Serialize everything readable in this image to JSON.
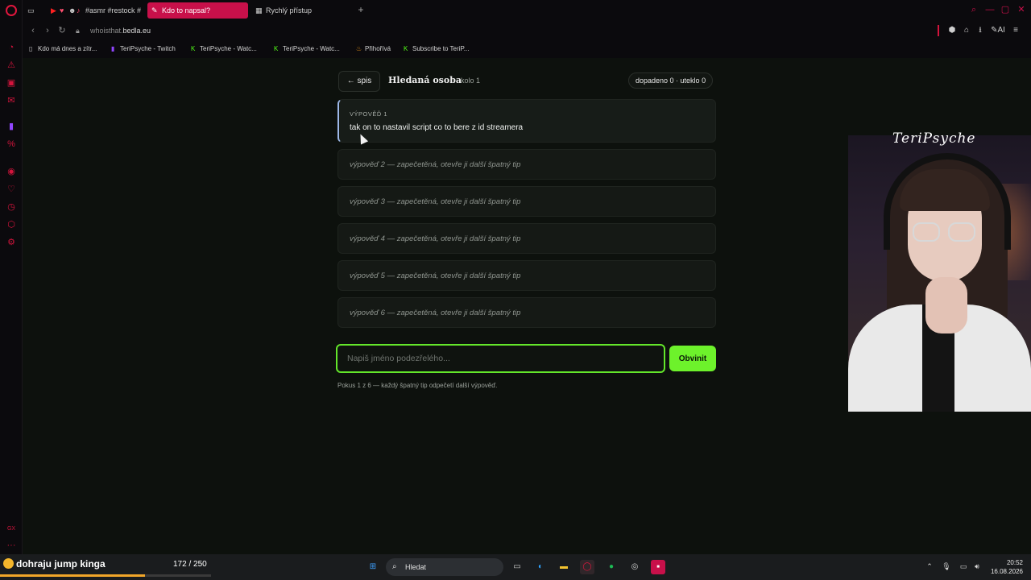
{
  "browser": {
    "tabs": [
      {
        "label": "#asmr #restock #",
        "icon": "youtube-icon"
      },
      {
        "label": "Kdo to napsal?",
        "icon": "page-icon",
        "active": true
      },
      {
        "label": "Rychlý přístup",
        "icon": "grid-icon"
      }
    ],
    "url_domain": "whoisthat.",
    "url_host": "bedla.eu",
    "toolbar_ai_label": "AI",
    "bookmarks": [
      {
        "label": "Kdo má dnes a zítr..."
      },
      {
        "label": "TeriPsyche - Twitch"
      },
      {
        "label": "TeriPsyche - Watc..."
      },
      {
        "label": "TeriPsyche - Watc..."
      },
      {
        "label": "Přihořívá"
      },
      {
        "label": "Subscribe to TeriP..."
      }
    ]
  },
  "game": {
    "back_label": "← spis",
    "title": "Hledaná osoba",
    "round": "kolo 1",
    "score": "dopadeno 0 · uteklo 0",
    "open_statement": {
      "label": "VÝPOVĚĎ 1",
      "text": "tak on to nastavil script co to bere z id streamera"
    },
    "sealed_statements": [
      "výpověď 2 — zapečetěná, otevře ji další špatný tip",
      "výpověď 3 — zapečetěná, otevře ji další špatný tip",
      "výpověď 4 — zapečetěná, otevře ji další špatný tip",
      "výpověď 5 — zapečetěná, otevře ji další špatný tip",
      "výpověď 6 — zapečetěná, otevře ji další špatný tip"
    ],
    "input_placeholder": "Napiš jméno podezřelého...",
    "accuse_label": "Obvinit",
    "hint": "Pokus 1 z 6 — každý špatný tip odpečetí další výpověď."
  },
  "stream": {
    "webcam_name": "TeriPsyche",
    "goal_text": "dohraju jump kinga",
    "goal_count": "172 / 250",
    "goal_progress": 0.688
  },
  "taskbar": {
    "search_label": "Hledat",
    "time": "20:52",
    "date": "16.08.2026"
  },
  "colors": {
    "accent_green": "#6df22b",
    "opera_red": "#d3143c",
    "statement_border": "#9db8e8"
  }
}
